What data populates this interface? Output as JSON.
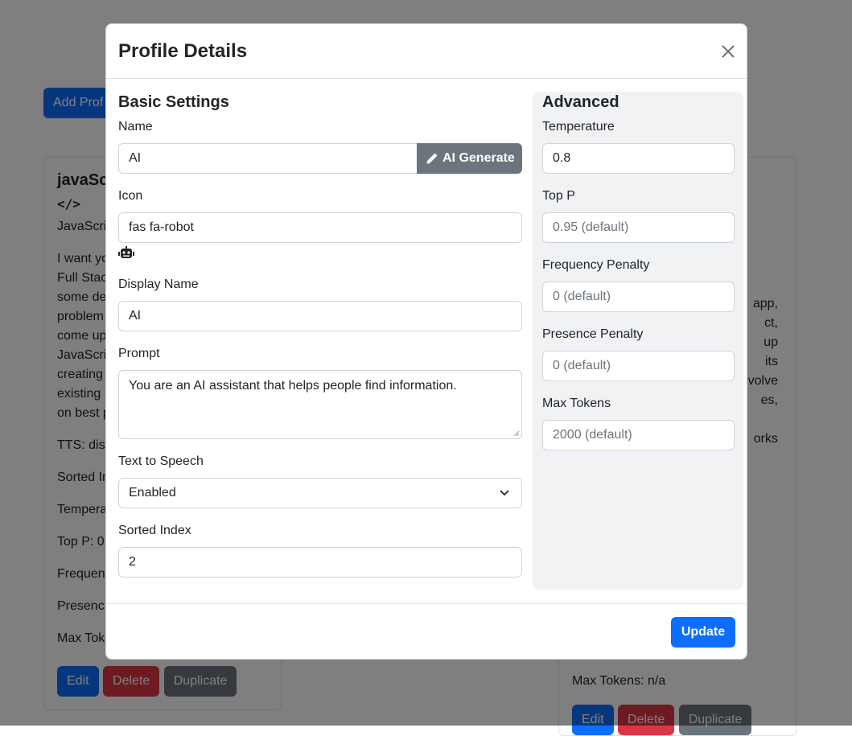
{
  "background": {
    "add_profile_label": "Add Prof",
    "left_card": {
      "title": "javaSc",
      "icon_text": "</>",
      "display_name": "JavaScri",
      "prompt_lines": [
        "I want yo",
        "Full Stac",
        "some de",
        "problem",
        "come up",
        "JavaScri",
        "creating",
        "existing",
        "on best p"
      ],
      "tts": "TTS: dis",
      "sorted": "Sorted In",
      "temperature": "Tempera",
      "top_p": "Top P: 0",
      "frequency": "Frequen",
      "presence": "Presenc",
      "max_tokens": "Max Tok",
      "edit_label": "Edit",
      "delete_label": "Delete",
      "duplicate_label": "Duplicate"
    },
    "right_card": {
      "prompt_lines": [
        "app,",
        "ct,",
        "up",
        "its",
        "volve",
        "es,",
        "",
        "orks"
      ],
      "max_tokens": "Max Tokens: n/a",
      "edit_label": "Edit",
      "delete_label": "Delete",
      "duplicate_label": "Duplicate"
    }
  },
  "modal": {
    "title": "Profile Details",
    "basic": {
      "heading": "Basic Settings",
      "name_label": "Name",
      "name_value": "AI",
      "ai_generate_label": "AI Generate",
      "icon_label": "Icon",
      "icon_value": "fas fa-robot",
      "icon_preview": "robot-icon",
      "display_name_label": "Display Name",
      "display_name_value": "AI",
      "prompt_label": "Prompt",
      "prompt_value": "You are an AI assistant that helps people find information.",
      "tts_label": "Text to Speech",
      "tts_value": "Enabled",
      "sorted_index_label": "Sorted Index",
      "sorted_index_value": "2"
    },
    "advanced": {
      "heading": "Advanced",
      "temperature_label": "Temperature",
      "temperature_value": "0.8",
      "top_p_label": "Top P",
      "top_p_placeholder": "0.95 (default)",
      "frequency_label": "Frequency Penalty",
      "frequency_placeholder": "0 (default)",
      "presence_label": "Presence Penalty",
      "presence_placeholder": "0 (default)",
      "max_tokens_label": "Max Tokens",
      "max_tokens_placeholder": "2000 (default)"
    },
    "update_label": "Update"
  },
  "colors": {
    "primary": "#0d6efd",
    "danger": "#dc3545",
    "secondary": "#6c757d",
    "advanced_panel": "#f1f2f4"
  }
}
